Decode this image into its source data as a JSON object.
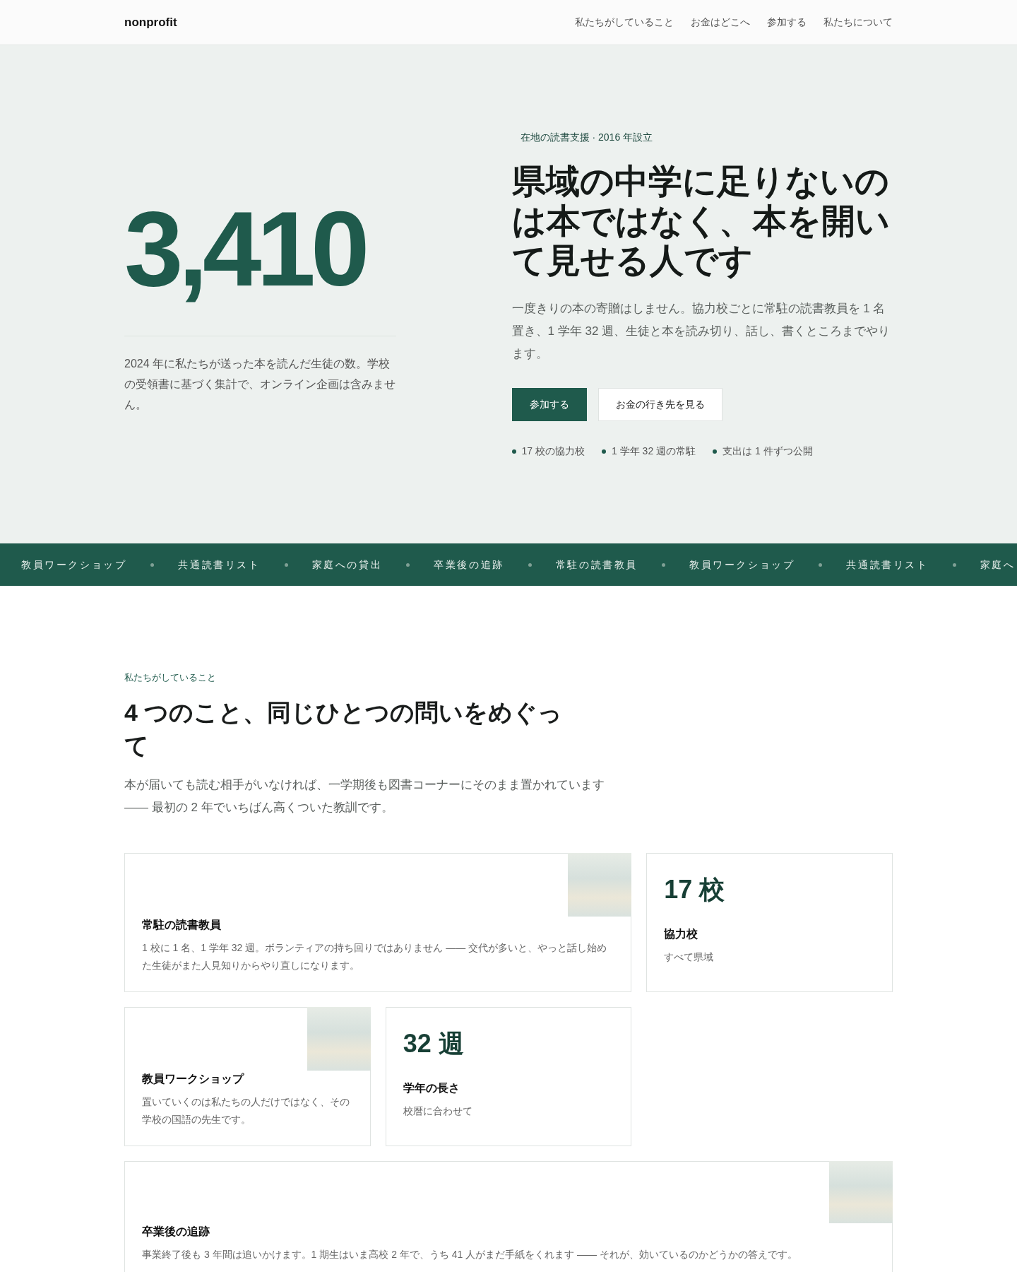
{
  "navbar": {
    "brand": "nonprofit",
    "links": [
      "私たちがしていること",
      "お金はどこへ",
      "参加する",
      "私たちについて"
    ]
  },
  "hero": {
    "stat": "3,410",
    "stat_caption": "2024 年に私たちが送った本を読んだ生徒の数。学校の受領書に基づく集計で、オンライン企画は含みません。",
    "eyebrow": "在地の読書支援 · 2016 年設立",
    "title": "県域の中学に足りないのは本ではなく、本を開いて見せる人です",
    "lead": "一度きりの本の寄贈はしません。協力校ごとに常駐の読書教員を 1 名置き、1 学年 32 週、生徒と本を読み切り、話し、書くところまでやります。",
    "buttons": [
      {
        "label": "参加する",
        "kind": "primary"
      },
      {
        "label": "お金の行き先を見る",
        "kind": "secondary"
      }
    ],
    "highlights": [
      "17 校の協力校",
      "1 学年 32 週の常駐",
      "支出は 1 件ずつ公開"
    ]
  },
  "ticker": [
    "教員ワークショップ",
    "共通読書リスト",
    "家庭への貸出",
    "卒業後の追跡",
    "常駐の読書教員",
    "教員ワークショップ",
    "共通読書リスト",
    "家庭へ"
  ],
  "section": {
    "eyebrow": "私たちがしていること",
    "title": "4 つのこと、同じひとつの問いをめぐって",
    "lead": "本が届いても読む相手がいなければ、一学期後も図書コーナーにそのまま置かれています —— 最初の 2 年でいちばん高くついた教訓です。"
  },
  "cards": [
    {
      "kind": "feature",
      "title": "常駐の読書教員",
      "text": "1 校に 1 名、1 学年 32 週。ボランティアの持ち回りではありません —— 交代が多いと、やっと話し始めた生徒がまた人見知りからやり直しになります。"
    },
    {
      "kind": "stat",
      "value": "17 校",
      "title": "協力校",
      "text": "すべて県域"
    },
    {
      "kind": "feature",
      "title": "教員ワークショップ",
      "text": "置いていくのは私たちの人だけではなく、その学校の国語の先生です。"
    },
    {
      "kind": "stat",
      "value": "32 週",
      "title": "学年の長さ",
      "text": "校暦に合わせて"
    },
    {
      "kind": "feature",
      "title": "卒業後の追跡",
      "text": "事業終了後も 3 年間は追いかけます。1 期生はいま高校 2 年で、うち 41 人がまだ手紙をくれます —— それが、効いているのかどうかの答えです。"
    }
  ]
}
